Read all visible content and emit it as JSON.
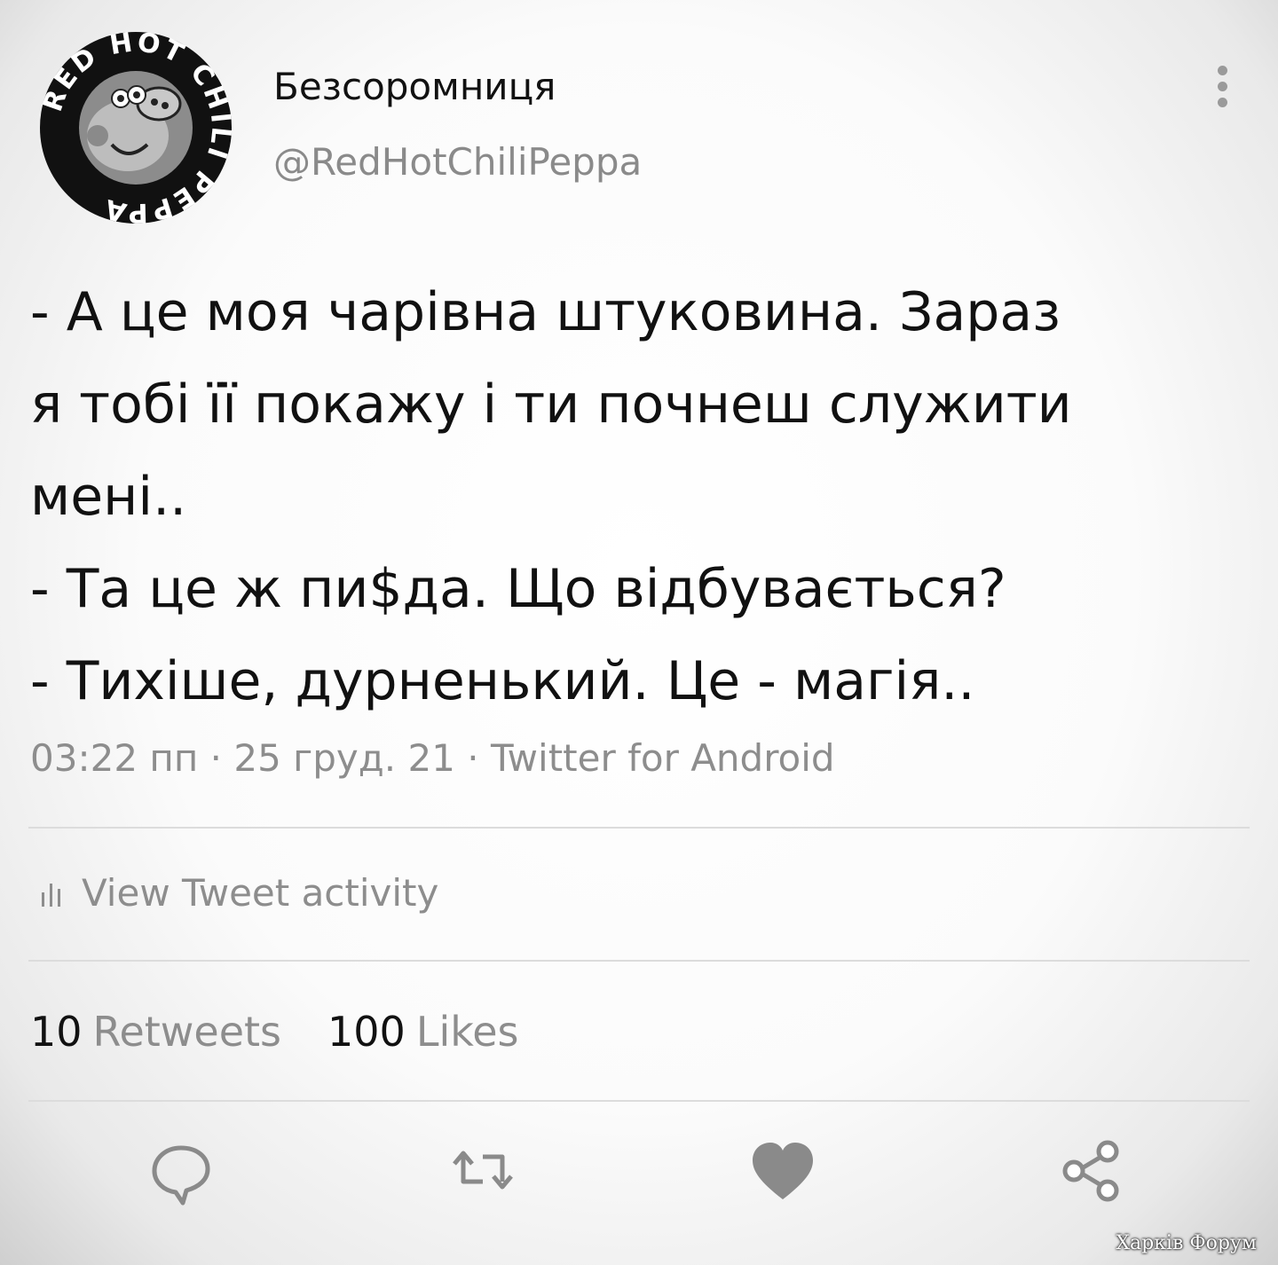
{
  "author": {
    "display_name": "Безсоромниця",
    "handle": "@RedHotChiliPeppa",
    "avatar_ring_text": "RED HOT CHILI PEPPA"
  },
  "tweet": {
    "lines": [
      "- А це моя чарівна штуковина. Зараз",
      "я тобі її покажу і ти почнеш служити",
      "мені..",
      "- Та це ж пи$да. Що відбувається?",
      "- Тихіше, дурненький. Це - магія.."
    ],
    "meta": "03:22 пп · 25 груд. 21 · Twitter for Android"
  },
  "activity": {
    "label": "View Tweet activity"
  },
  "stats": {
    "retweets_count": "10",
    "retweets_label": "Retweets",
    "likes_count": "100",
    "likes_label": "Likes"
  },
  "actions": {
    "icons": [
      "reply-icon",
      "retweet-icon",
      "like-icon",
      "share-icon"
    ],
    "icon_color": "#8a8a8a",
    "like_color": "#8a8a8a"
  },
  "watermark": "Харків Форум"
}
